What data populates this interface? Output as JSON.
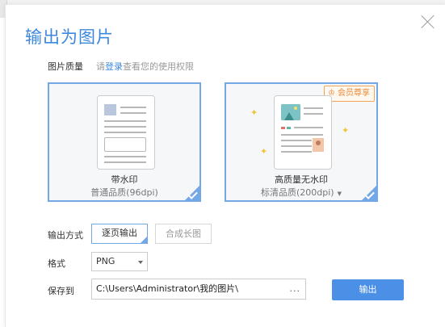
{
  "dialog": {
    "title": "输出为图片"
  },
  "quality": {
    "label": "图片质量",
    "hint_prefix": "请",
    "hint_link": "登录",
    "hint_suffix": "查看您的使用权限",
    "options": [
      {
        "name": "带水印",
        "detail": "普通品质(96dpi)",
        "selected": true
      },
      {
        "name": "高质量无水印",
        "detail": "标清品质(200dpi)",
        "badge": "会员尊享",
        "selected": true
      }
    ]
  },
  "output_mode": {
    "label": "输出方式",
    "options": [
      "逐页输出",
      "合成长图"
    ],
    "selected": "逐页输出"
  },
  "format": {
    "label": "格式",
    "value": "PNG"
  },
  "save_to": {
    "label": "保存到",
    "path": "C:\\Users\\Administrator\\我的图片\\",
    "browse": "..."
  },
  "actions": {
    "export_label": "输出"
  },
  "colors": {
    "accent": "#3c88df",
    "primary_button": "#4c8fe6",
    "vip": "#e9893a"
  }
}
